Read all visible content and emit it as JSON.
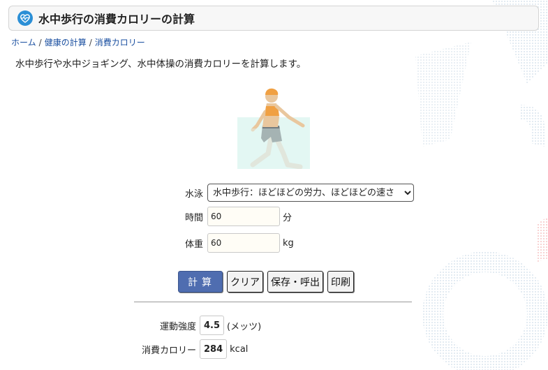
{
  "title": "水中歩行の消費カロリーの計算",
  "breadcrumb": {
    "home": "ホーム",
    "health": "健康の計算",
    "current": "消費カロリー",
    "separator": "/"
  },
  "lead": "水中歩行や水中ジョギング、水中体操の消費カロリーを計算します。",
  "form": {
    "stroke_label": "水泳",
    "stroke_selected": "水中歩行：ほどほどの労力、ほどほどの速さ",
    "time_label": "時間",
    "time_value": "60",
    "time_unit": "分",
    "weight_label": "体重",
    "weight_value": "60",
    "weight_unit": "kg"
  },
  "buttons": {
    "calc": "計算",
    "clear": "クリア",
    "save": "保存・呼出",
    "print": "印刷"
  },
  "results": {
    "intensity_label": "運動強度",
    "intensity_value": "4.5",
    "intensity_unit": "(メッツ)",
    "calorie_label": "消費カロリー",
    "calorie_value": "284",
    "calorie_unit": "kcal"
  },
  "icons": {
    "title": "heart-pulse-icon",
    "figure": "water-walking-figure"
  },
  "colors": {
    "accent": "#4f6db0",
    "title_icon": "#2b8fd6",
    "water": "#e3f7f3",
    "swimsuit": "#f0a043",
    "link": "#1a4fa0"
  }
}
